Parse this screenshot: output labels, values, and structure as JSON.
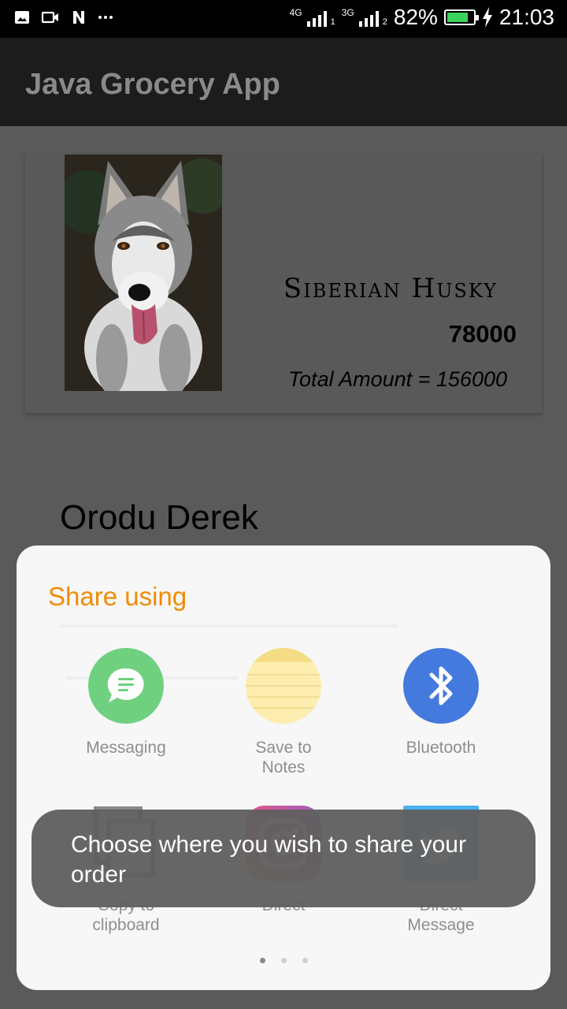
{
  "status_bar": {
    "notification_icons": [
      "gallery-icon",
      "video-icon",
      "n-icon",
      "more-dots-icon"
    ],
    "sim1_network": "4G",
    "sim1_slot": "1",
    "sim2_network": "3G",
    "sim2_slot": "2",
    "battery_percent": "82%",
    "battery_level": 0.82,
    "battery_color": "#3cd35a",
    "time": "21:03"
  },
  "app_bar": {
    "title": "Java Grocery App"
  },
  "order": {
    "product_name": "Siberian Husky",
    "product_image": "siberian-husky-photo",
    "price": "78000",
    "total": "Total Amount = 156000"
  },
  "customer": {
    "name": "Orodu Derek"
  },
  "share_sheet": {
    "title": "Share using",
    "title_color": "#f28a00",
    "options": [
      {
        "label": "Messaging",
        "icon": "messaging-icon",
        "color": "#6fd17f"
      },
      {
        "label": "Save to\nNotes",
        "icon": "notes-icon",
        "color": "#fdeeb0"
      },
      {
        "label": "Bluetooth",
        "icon": "bluetooth-icon",
        "color": "#4479dd"
      },
      {
        "label": "Copy to\nclipboard",
        "icon": "copy-icon",
        "color": "#707070"
      },
      {
        "label": "Direct",
        "icon": "instagram-icon",
        "color": "#c13584"
      },
      {
        "label": "Direct\nMessage",
        "icon": "twitter-icon",
        "color": "#1da1f2"
      }
    ],
    "page_count": 3,
    "current_page": 1
  },
  "toast": {
    "message": "Choose where you wish to share your order"
  }
}
